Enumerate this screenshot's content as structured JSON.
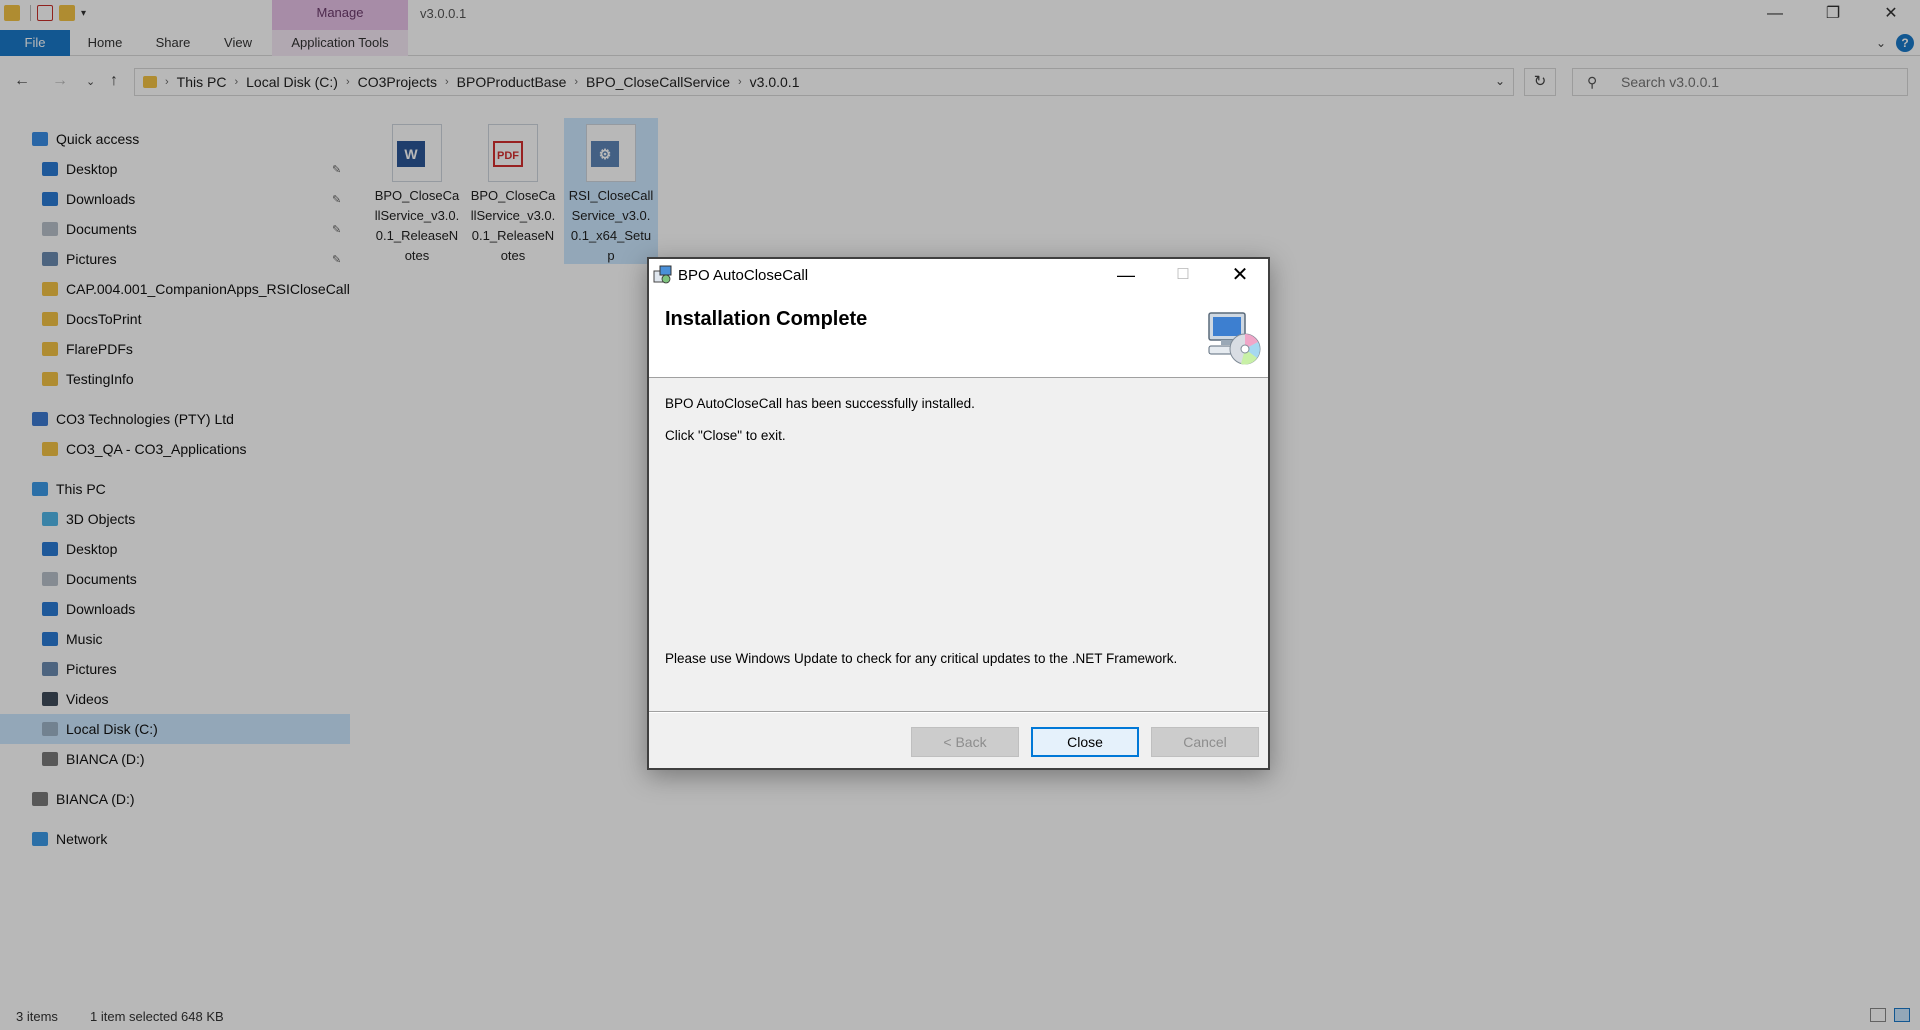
{
  "explorer": {
    "window_title": "v3.0.0.1",
    "manage_tab": "Manage",
    "ribbon_tabs": {
      "file": "File",
      "home": "Home",
      "share": "Share",
      "view": "View",
      "app_tools": "Application Tools"
    },
    "help": "?",
    "breadcrumb": [
      "This PC",
      "Local Disk (C:)",
      "CO3Projects",
      "BPOProductBase",
      "BPO_CloseCallService",
      "v3.0.0.1"
    ],
    "search_placeholder": "Search v3.0.0.1",
    "nav": {
      "quick_access": "Quick access",
      "qa_items": [
        "Desktop",
        "Downloads",
        "Documents",
        "Pictures",
        "CAP.004.001_CompanionApps_RSICloseCall",
        "DocsToPrint",
        "FlarePDFs",
        "TestingInfo"
      ],
      "org": "CO3 Technologies (PTY) Ltd",
      "org_items": [
        "CO3_QA - CO3_Applications"
      ],
      "this_pc": "This PC",
      "pc_items": [
        "3D Objects",
        "Desktop",
        "Documents",
        "Downloads",
        "Music",
        "Pictures",
        "Videos",
        "Local Disk (C:)",
        "BIANCA (D:)"
      ],
      "drive": "BIANCA (D:)",
      "network": "Network"
    },
    "files": [
      {
        "name": "BPO_CloseCallService_v3.0.0.1_ReleaseNotes",
        "badge": "W",
        "icon": "word-doc-icon"
      },
      {
        "name": "BPO_CloseCallService_v3.0.0.1_ReleaseNotes",
        "badge": "PDF",
        "icon": "pdf-doc-icon"
      },
      {
        "name": "RSI_CloseCallService_v3.0.0.1_x64_Setup",
        "badge": "⚙",
        "icon": "installer-icon"
      }
    ],
    "status": {
      "count": "3 items",
      "selection": "1 item selected  648 KB"
    }
  },
  "dialog": {
    "title": "BPO AutoCloseCall",
    "heading": "Installation Complete",
    "line1": "BPO AutoCloseCall has been successfully installed.",
    "line2": "Click \"Close\" to exit.",
    "line3": "Please use Windows Update to check for any critical updates to the .NET Framework.",
    "buttons": {
      "back": "< Back",
      "close": "Close",
      "cancel": "Cancel"
    }
  }
}
